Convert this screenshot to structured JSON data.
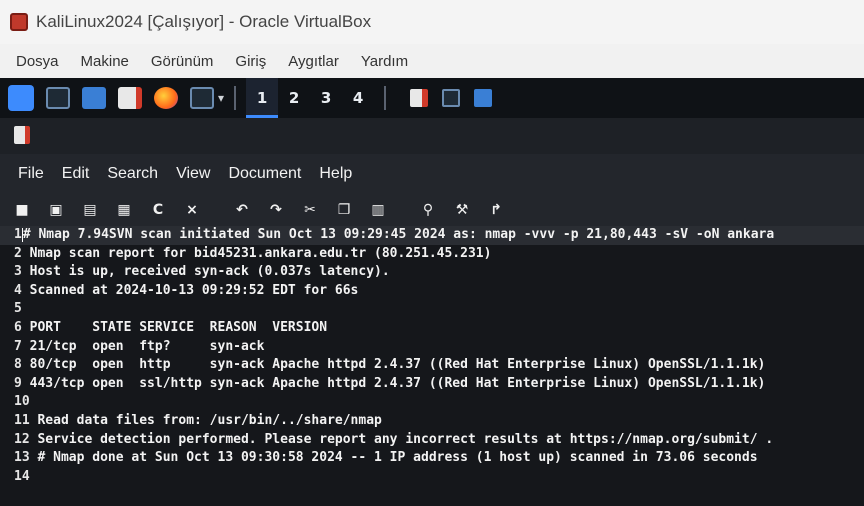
{
  "vbox": {
    "title": "KaliLinux2024 [Çalışıyor] - Oracle VirtualBox",
    "menu": [
      "Dosya",
      "Makine",
      "Görünüm",
      "Giriş",
      "Aygıtlar",
      "Yardım"
    ]
  },
  "panel": {
    "workspaces": [
      "1",
      "2",
      "3",
      "4"
    ],
    "active_workspace": "1",
    "icons": [
      "kali-dragon-icon",
      "terminal-icon",
      "folder-icon",
      "text-editor-icon",
      "firefox-icon",
      "terminal-emulator-icon"
    ]
  },
  "editor_app": {
    "menu": [
      "File",
      "Edit",
      "Search",
      "View",
      "Document",
      "Help"
    ],
    "toolbar_icons": [
      "new-icon",
      "new-window-icon",
      "save-icon",
      "save-as-icon",
      "reload-icon",
      "close-icon",
      "undo-icon",
      "redo-icon",
      "cut-icon",
      "copy-icon",
      "paste-icon",
      "find-icon",
      "replace-icon",
      "goto-icon"
    ],
    "toolbar_glyphs": [
      "C",
      "×",
      "⮌",
      "⮎",
      "✂",
      "⧉",
      "🗋",
      "⚲",
      "⚒",
      "↷"
    ]
  },
  "document": {
    "lines": [
      {
        "n": "1",
        "text": "# Nmap 7.94SVN scan initiated Sun Oct 13 09:29:45 2024 as: nmap -vvv -p 21,80,443 -sV -oN ankara"
      },
      {
        "n": "2",
        "text": "Nmap scan report for bid45231.ankara.edu.tr (80.251.45.231)"
      },
      {
        "n": "3",
        "text": "Host is up, received syn-ack (0.037s latency)."
      },
      {
        "n": "4",
        "text": "Scanned at 2024-10-13 09:29:52 EDT for 66s"
      },
      {
        "n": "5",
        "text": ""
      },
      {
        "n": "6",
        "text": "PORT    STATE SERVICE  REASON  VERSION"
      },
      {
        "n": "7",
        "text": "21/tcp  open  ftp?     syn-ack"
      },
      {
        "n": "8",
        "text": "80/tcp  open  http     syn-ack Apache httpd 2.4.37 ((Red Hat Enterprise Linux) OpenSSL/1.1.1k)"
      },
      {
        "n": "9",
        "text": "443/tcp open  ssl/http syn-ack Apache httpd 2.4.37 ((Red Hat Enterprise Linux) OpenSSL/1.1.1k)"
      },
      {
        "n": "10",
        "text": ""
      },
      {
        "n": "11",
        "text": "Read data files from: /usr/bin/../share/nmap"
      },
      {
        "n": "12",
        "text": "Service detection performed. Please report any incorrect results at https://nmap.org/submit/ ."
      },
      {
        "n": "13",
        "text": "# Nmap done at Sun Oct 13 09:30:58 2024 -- 1 IP address (1 host up) scanned in 73.06 seconds"
      },
      {
        "n": "14",
        "text": ""
      }
    ]
  },
  "colors": {
    "accent": "#3d8bfd",
    "editor_bg": "#15171b",
    "current_line": "#2a2d33"
  }
}
